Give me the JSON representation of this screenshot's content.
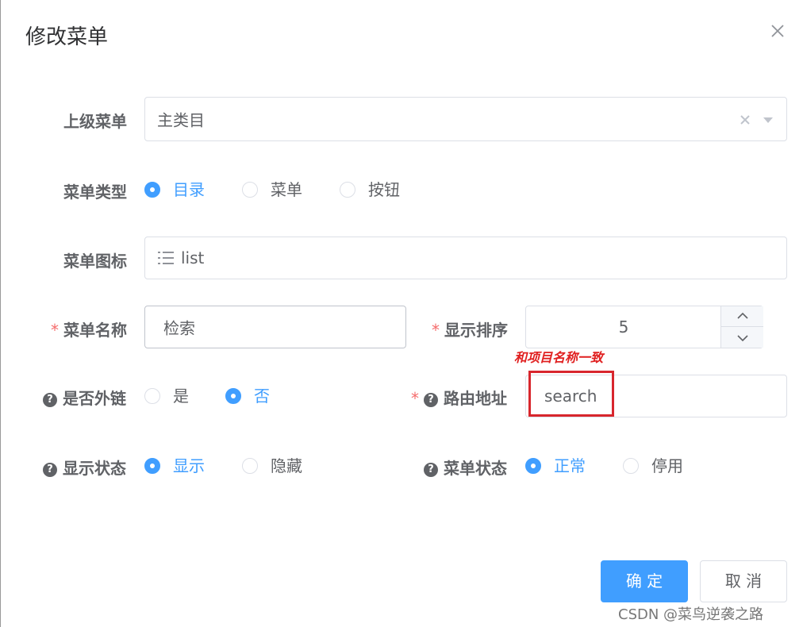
{
  "dialog": {
    "title": "修改菜单",
    "close_icon": "close-icon"
  },
  "form": {
    "parent_menu": {
      "label": "上级菜单",
      "value": "主类目",
      "clear_icon": "clear-icon",
      "arrow_icon": "caret-down-icon"
    },
    "menu_type": {
      "label": "菜单类型",
      "options": [
        "目录",
        "菜单",
        "按钮"
      ],
      "selected": "目录"
    },
    "menu_icon": {
      "label": "菜单图标",
      "icon": "list-icon",
      "value": "list"
    },
    "menu_name": {
      "label": "菜单名称",
      "required": "*",
      "value": "检索"
    },
    "sort_order": {
      "label": "显示排序",
      "required": "*",
      "value": "5",
      "up_icon": "chevron-up-icon",
      "down_icon": "chevron-down-icon"
    },
    "external_link": {
      "label": "是否外链",
      "help_icon": "question-icon",
      "options": [
        "是",
        "否"
      ],
      "selected": "否"
    },
    "route_path": {
      "label": "路由地址",
      "required": "*",
      "help_icon": "question-icon",
      "value": "search"
    },
    "visible": {
      "label": "显示状态",
      "help_icon": "question-icon",
      "options": [
        "显示",
        "隐藏"
      ],
      "selected": "显示"
    },
    "status": {
      "label": "菜单状态",
      "help_icon": "question-icon",
      "options": [
        "正常",
        "停用"
      ],
      "selected": "正常"
    }
  },
  "annotation": {
    "text": "和项目名称一致"
  },
  "footer": {
    "confirm": "确 定",
    "cancel": "取 消"
  },
  "watermark": "CSDN @菜鸟逆袭之路",
  "colors": {
    "primary": "#409eff",
    "required": "#f56c6c",
    "annotation": "#e02020"
  }
}
